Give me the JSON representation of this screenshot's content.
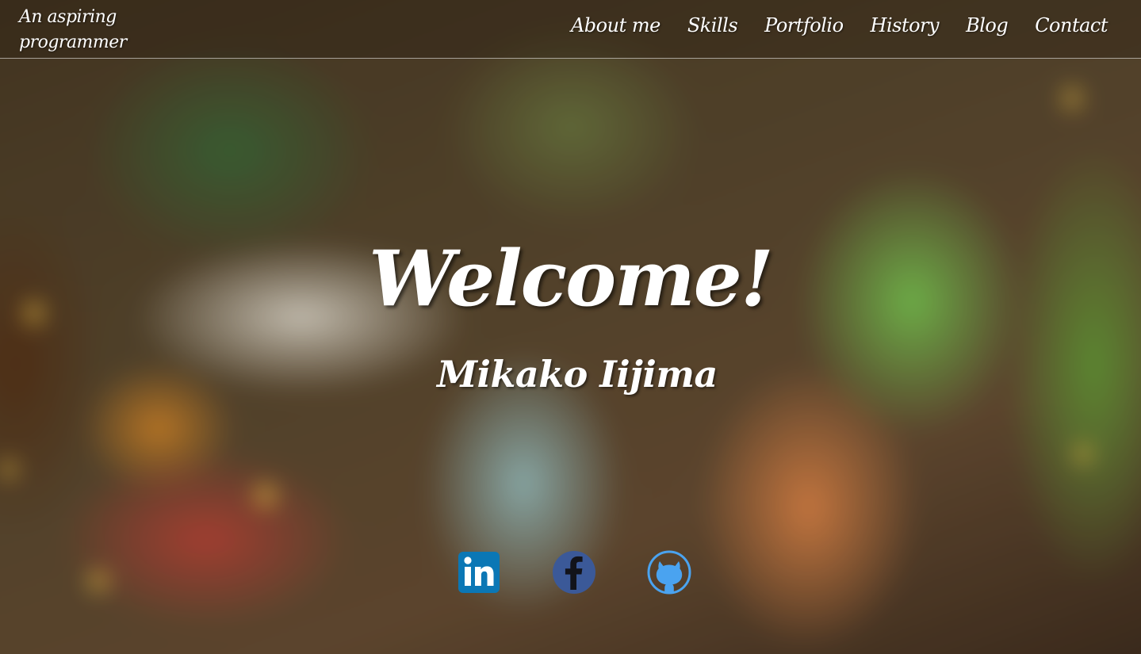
{
  "header": {
    "brand": "An aspiring programmer"
  },
  "nav": {
    "items": [
      "About me",
      "Skills",
      "Portfolio",
      "History",
      "Blog",
      "Contact"
    ]
  },
  "hero": {
    "title": "Welcome!",
    "subtitle": "Mikako Iijima"
  },
  "social": {
    "icons": [
      "linkedin-icon",
      "facebook-icon",
      "github-icon"
    ],
    "colors": {
      "linkedin": "#0b77b5",
      "facebook": "#3b5998",
      "github": "#4aa3f0"
    }
  }
}
